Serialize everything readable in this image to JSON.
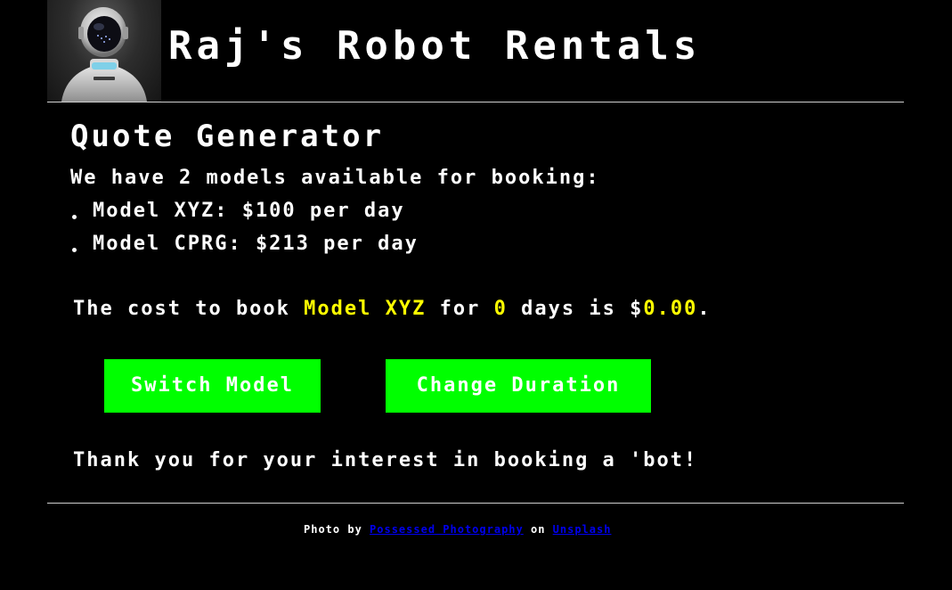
{
  "header": {
    "title": "Raj's Robot Rentals",
    "photo": "robot-photo"
  },
  "quote": {
    "heading": "Quote Generator",
    "intro": "We have 2 models available for booking:",
    "models": [
      {
        "label": "Model XYZ: $100 per day"
      },
      {
        "label": "Model CPRG: $213 per day"
      }
    ],
    "cost_prefix": "The cost to book ",
    "selected_model": "Model XYZ",
    "cost_middle": " for ",
    "days": "0",
    "cost_days_suffix": " days is $",
    "total": "0.00",
    "cost_end": "."
  },
  "buttons": {
    "switch_model": "Switch Model",
    "change_duration": "Change Duration"
  },
  "thanks": "Thank you for your interest in booking a 'bot!",
  "footer": {
    "prefix": "Photo by ",
    "photographer": "Possessed Photography",
    "middle": " on ",
    "site": "Unsplash"
  },
  "colors": {
    "background": "#000000",
    "text": "#ffffff",
    "highlight": "#ffff00",
    "button": "#00ff00",
    "link": "#0000ee"
  }
}
